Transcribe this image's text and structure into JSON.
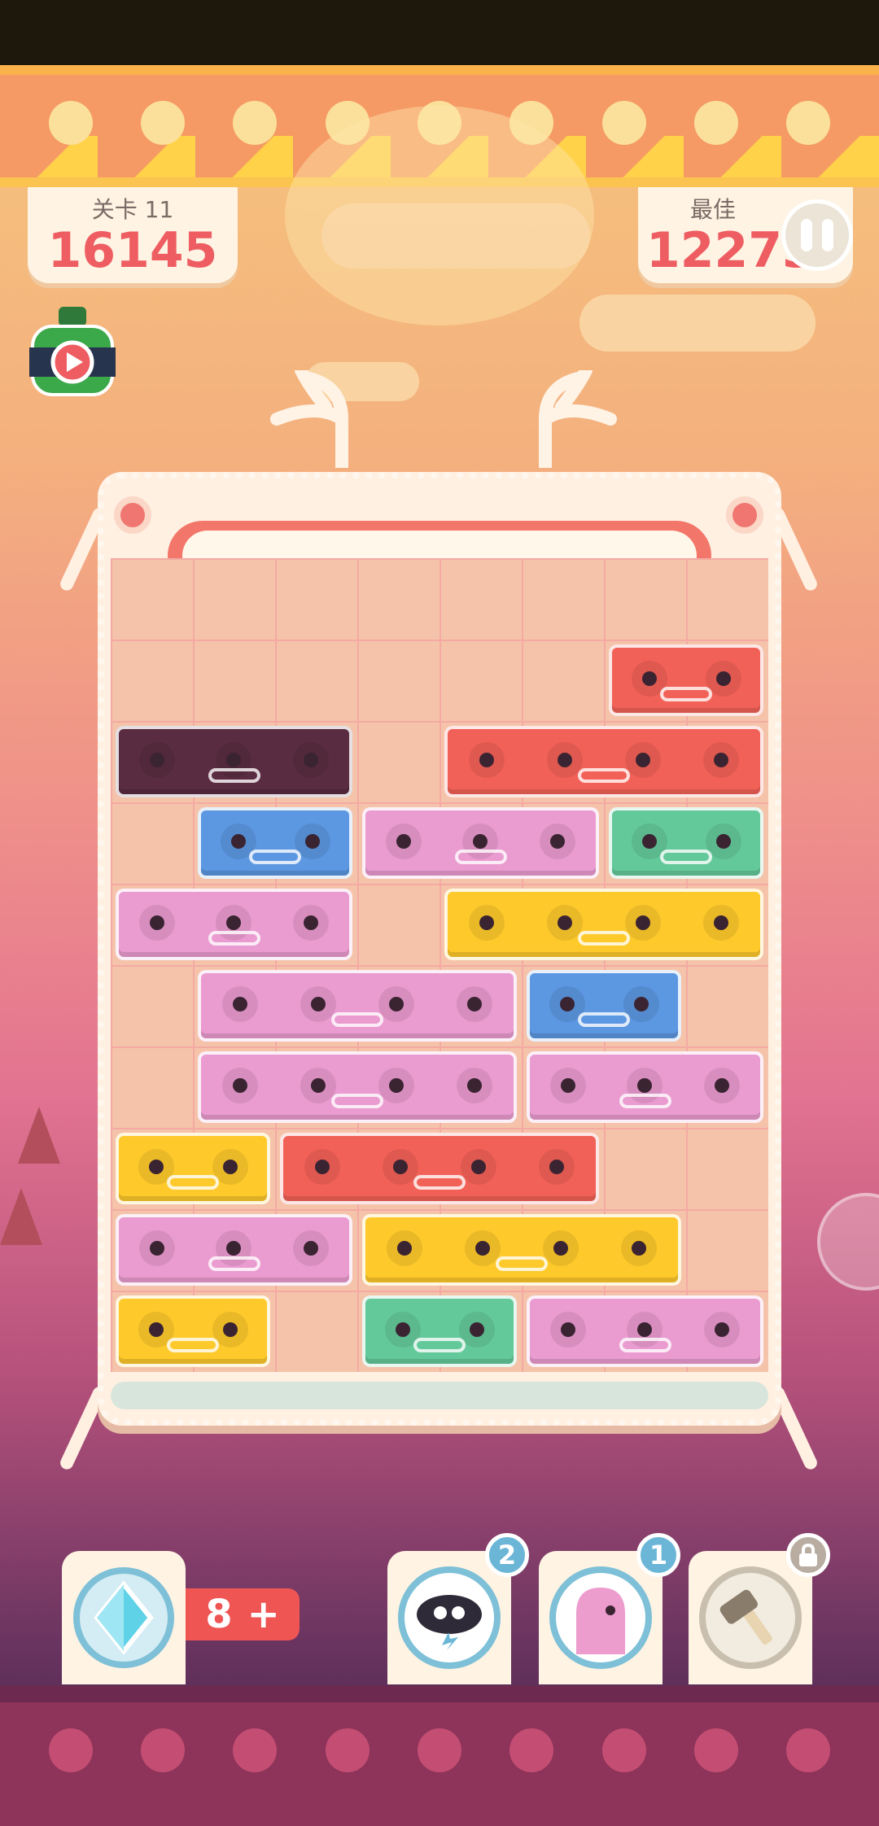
{
  "hud": {
    "level_label": "关卡 11",
    "score": "16145",
    "best_label": "最佳",
    "best_score": "12273"
  },
  "powerups": {
    "gem_count": "8",
    "gem_plus": "+",
    "storm_count": "2",
    "ghost_count": "1",
    "hammer_locked": true
  },
  "icons": {
    "pause": "pause-icon",
    "potion": "potion-video-icon",
    "gem": "diamond-icon",
    "storm": "storm-cloud-icon",
    "ghost": "ghost-icon",
    "hammer": "hammer-icon",
    "lock": "lock-icon"
  },
  "colors": {
    "red": "#f26157",
    "pink": "#ea9bd0",
    "blue": "#5c97e1",
    "green": "#63c99a",
    "yellow": "#fec92b",
    "dark": "#5a2c41"
  },
  "board": {
    "columns": 8,
    "rows": 10,
    "blocks": [
      {
        "row": 1,
        "col": 6,
        "len": 2,
        "color": "red"
      },
      {
        "row": 2,
        "col": 0,
        "len": 3,
        "color": "dark"
      },
      {
        "row": 2,
        "col": 4,
        "len": 4,
        "color": "red"
      },
      {
        "row": 3,
        "col": 1,
        "len": 2,
        "color": "blue"
      },
      {
        "row": 3,
        "col": 3,
        "len": 3,
        "color": "pink"
      },
      {
        "row": 3,
        "col": 6,
        "len": 2,
        "color": "green"
      },
      {
        "row": 4,
        "col": 0,
        "len": 3,
        "color": "pink"
      },
      {
        "row": 4,
        "col": 4,
        "len": 4,
        "color": "yellow"
      },
      {
        "row": 5,
        "col": 1,
        "len": 4,
        "color": "pink"
      },
      {
        "row": 5,
        "col": 5,
        "len": 2,
        "color": "blue"
      },
      {
        "row": 6,
        "col": 1,
        "len": 4,
        "color": "pink"
      },
      {
        "row": 6,
        "col": 5,
        "len": 3,
        "color": "pink"
      },
      {
        "row": 7,
        "col": 0,
        "len": 2,
        "color": "yellow"
      },
      {
        "row": 7,
        "col": 2,
        "len": 4,
        "color": "red"
      },
      {
        "row": 8,
        "col": 0,
        "len": 3,
        "color": "pink"
      },
      {
        "row": 8,
        "col": 3,
        "len": 4,
        "color": "yellow"
      },
      {
        "row": 9,
        "col": 0,
        "len": 2,
        "color": "yellow"
      },
      {
        "row": 9,
        "col": 3,
        "len": 2,
        "color": "green"
      },
      {
        "row": 9,
        "col": 5,
        "len": 3,
        "color": "pink"
      }
    ]
  }
}
